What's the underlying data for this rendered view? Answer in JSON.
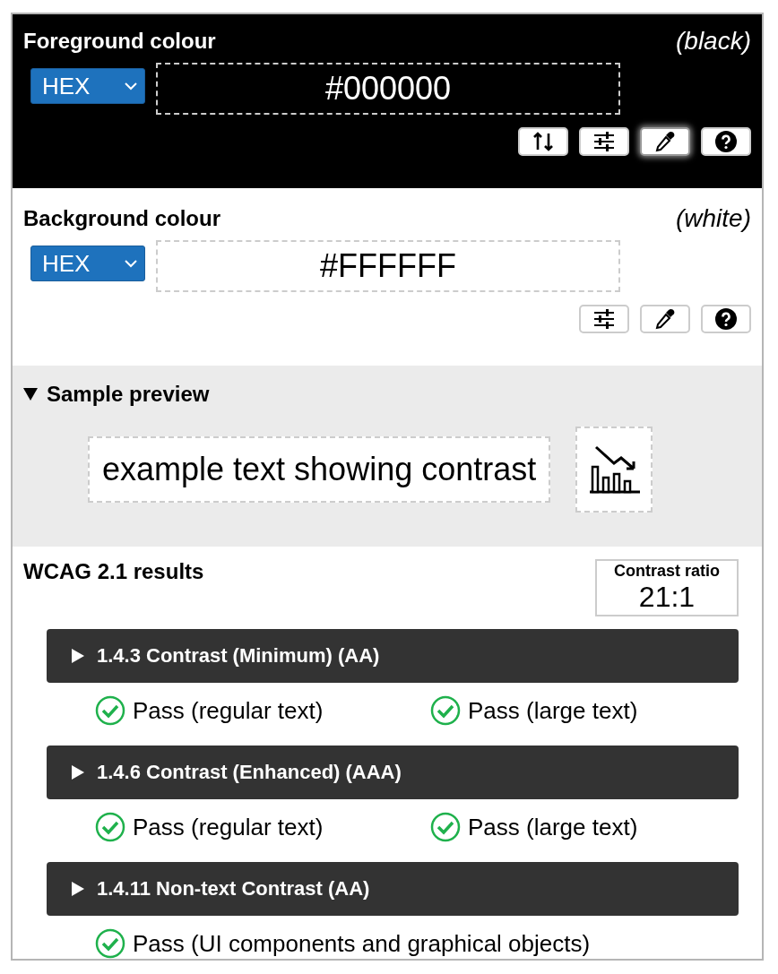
{
  "colours": [
    {
      "kind": "foreground",
      "title": "Foreground colour",
      "name": "(black)",
      "format": "HEX",
      "value": "#000000",
      "tools": [
        {
          "kind": "swap",
          "active": false
        },
        {
          "kind": "sliders",
          "active": false
        },
        {
          "kind": "eyedropper",
          "active": true
        },
        {
          "kind": "help",
          "active": false
        }
      ]
    },
    {
      "kind": "background",
      "title": "Background colour",
      "name": "(white)",
      "format": "HEX",
      "value": "#FFFFFF",
      "tools": [
        {
          "kind": "sliders",
          "active": false
        },
        {
          "kind": "eyedropper",
          "active": false
        },
        {
          "kind": "help",
          "active": false
        }
      ]
    }
  ],
  "preview": {
    "title": "Sample preview",
    "expanded": true,
    "sample_text": "example text showing contrast"
  },
  "results": {
    "title": "WCAG 2.1 results",
    "ratio_label": "Contrast ratio",
    "ratio": "21:1",
    "criteria": [
      {
        "title": "1.4.3 Contrast (Minimum) (AA)",
        "expanded": false,
        "checks": [
          {
            "passed": true,
            "text": "Pass (regular text)"
          },
          {
            "passed": true,
            "text": "Pass (large text)"
          }
        ]
      },
      {
        "title": "1.4.6 Contrast (Enhanced) (AAA)",
        "expanded": false,
        "checks": [
          {
            "passed": true,
            "text": "Pass (regular text)"
          },
          {
            "passed": true,
            "text": "Pass (large text)"
          }
        ]
      },
      {
        "title": "1.4.11 Non-text Contrast (AA)",
        "expanded": false,
        "checks": [
          {
            "passed": true,
            "text": "Pass (UI components and graphical objects)"
          }
        ]
      }
    ]
  }
}
